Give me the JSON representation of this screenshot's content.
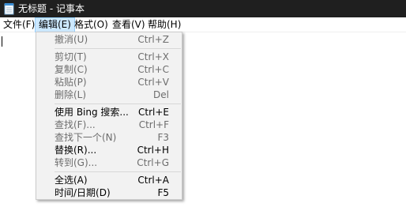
{
  "window": {
    "title": "无标题 - 记事本"
  },
  "menubar": {
    "items": [
      {
        "label": "文件(F)"
      },
      {
        "label": "编辑(E)"
      },
      {
        "label": "格式(O)"
      },
      {
        "label": "查看(V)"
      },
      {
        "label": "帮助(H)"
      }
    ]
  },
  "edit_menu": {
    "items": [
      {
        "label": "撤消(U)",
        "shortcut": "Ctrl+Z",
        "enabled": false
      },
      {
        "label": "剪切(T)",
        "shortcut": "Ctrl+X",
        "enabled": false
      },
      {
        "label": "复制(C)",
        "shortcut": "Ctrl+C",
        "enabled": false
      },
      {
        "label": "粘贴(P)",
        "shortcut": "Ctrl+V",
        "enabled": false
      },
      {
        "label": "删除(L)",
        "shortcut": "Del",
        "enabled": false
      },
      {
        "label": "使用 Bing 搜索...",
        "shortcut": "Ctrl+E",
        "enabled": true
      },
      {
        "label": "查找(F)...",
        "shortcut": "Ctrl+F",
        "enabled": false
      },
      {
        "label": "查找下一个(N)",
        "shortcut": "F3",
        "enabled": false
      },
      {
        "label": "替换(R)...",
        "shortcut": "Ctrl+H",
        "enabled": true
      },
      {
        "label": "转到(G)...",
        "shortcut": "Ctrl+G",
        "enabled": false
      },
      {
        "label": "全选(A)",
        "shortcut": "Ctrl+A",
        "enabled": true
      },
      {
        "label": "时间/日期(D)",
        "shortcut": "F5",
        "enabled": true
      }
    ]
  },
  "colors": {
    "titlebar_bg": "#1f1f1f",
    "menu_highlight_bg": "#cce8ff",
    "menu_highlight_border": "#99d1ff",
    "dropdown_bg": "#f2f2f2",
    "disabled_text": "#6d6d6d"
  }
}
